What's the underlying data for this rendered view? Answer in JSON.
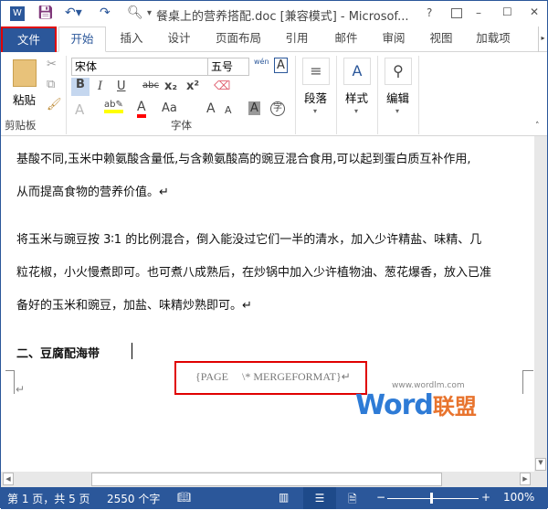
{
  "title": "餐桌上的营养搭配.doc [兼容模式] - Microsof...",
  "window_controls": {
    "help": "?",
    "minimize": "–",
    "maximize": "☐",
    "close": "✕"
  },
  "tabs": [
    "文件",
    "开始",
    "插入",
    "设计",
    "页面布局",
    "引用",
    "邮件",
    "审阅",
    "视图",
    "加载项"
  ],
  "ribbon": {
    "clipboard": {
      "paste": "粘贴",
      "label": "剪贴板"
    },
    "font": {
      "name": "宋体",
      "size": "五号",
      "bold": "B",
      "italic": "I",
      "underline": "U",
      "strike": "abc",
      "sub": "x₂",
      "sup": "x²",
      "change_case": "Aa",
      "grow": "A",
      "shrink": "A",
      "label": "字体",
      "phonetic": "wén"
    },
    "paragraph": {
      "label": "段落"
    },
    "styles": {
      "label": "样式"
    },
    "editing": {
      "label": "编辑"
    },
    "colors": {
      "highlight": "#ffff00",
      "font_color": "#ff0000"
    }
  },
  "document": {
    "lines": [
      "基酸不同,玉米中赖氨酸含量低,与含赖氨酸高的豌豆混合食用,可以起到蛋白质互补作用,",
      "从而提高食物的营养价值。↵",
      "将玉米与豌豆按 3∶1 的比例混合，倒入能没过它们一半的清水，加入少许精盐、味精、几",
      "粒花椒，小火慢煮即可。也可煮八成熟后，在炒锅中加入少许植物油、葱花爆香，放入已准",
      "备好的玉米和豌豆，加盐、味精炒熟即可。↵"
    ],
    "heading": "二、豆腐配海带",
    "field_code": "{PAGE     \\* MERGEFORMAT}↵",
    "watermark": {
      "url": "www.wordlm.com",
      "word": "Word",
      "cn": "联盟"
    }
  },
  "status": {
    "page": "第 1 页，共 5 页",
    "words": "2550 个字",
    "zoom": "100%",
    "zoom_level": 100
  },
  "accent": "#2b579a"
}
